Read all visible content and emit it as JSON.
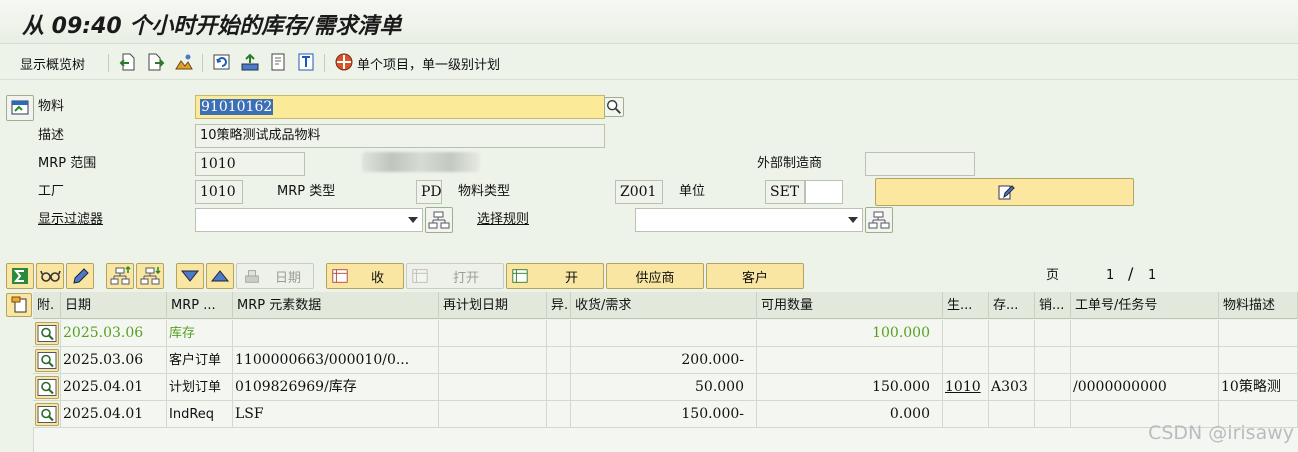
{
  "title": "从 09:40 个小时开始的库存/需求清单",
  "toolbar": {
    "overview_tree": "显示概览树",
    "single_item": "单个项目，单一级别计划"
  },
  "header": {
    "material_label": "物料",
    "material_value": "91010162",
    "desc_label": "描述",
    "desc_value": "10策略测试成品物料",
    "mrp_area_label": "MRP 范围",
    "mrp_area_value": "1010",
    "ext_mfr_label": "外部制造商",
    "ext_mfr_value": "",
    "plant_label": "工厂",
    "plant_value": "1010",
    "mrp_type_label": "MRP 类型",
    "mrp_type_value": "PD",
    "mat_type_label": "物料类型",
    "mat_type_value": "Z001",
    "unit_label": "单位",
    "unit_value": "SET",
    "filter_label": "显示过滤器",
    "rule_label": "选择规则"
  },
  "actions": {
    "date": "日期",
    "receipt": "收",
    "open": "打开",
    "open2": "开",
    "supplier": "供应商",
    "customer": "客户",
    "page_label": "页",
    "page_current": "1",
    "page_sep": "/",
    "page_total": "1"
  },
  "grid": {
    "headers": [
      "附.",
      "日期",
      "MRP ...",
      "MRP 元素数据",
      "再计划日期",
      "异.",
      "收货/需求",
      "可用数量",
      "生...",
      "存...",
      "销...",
      "工单号/任务号",
      "物料描述"
    ],
    "rows": [
      {
        "date": "2025.03.06",
        "mrp": "库存",
        "data": "",
        "resched": "",
        "exc": "",
        "qty": "",
        "avail": "100.000",
        "gen": "",
        "stor": "",
        "sales": "",
        "order": "",
        "desc": ""
      },
      {
        "date": "2025.03.06",
        "mrp": "客户订单",
        "data": "1100000663/000010/0...",
        "resched": "",
        "exc": "",
        "qty": "200.000-",
        "avail": "",
        "gen": "",
        "stor": "",
        "sales": "",
        "order": "",
        "desc": ""
      },
      {
        "date": "2025.04.01",
        "mrp": "计划订单",
        "data": "0109826969/库存",
        "resched": "",
        "exc": "",
        "qty": "50.000",
        "avail": "150.000",
        "gen": "1010",
        "stor": "A303",
        "sales": "",
        "order": "/0000000000",
        "desc": "10策略测"
      },
      {
        "date": "2025.04.01",
        "mrp": "IndReq",
        "data": "LSF",
        "resched": "",
        "exc": "",
        "qty": "150.000-",
        "avail": "0.000",
        "gen": "",
        "stor": "",
        "sales": "",
        "order": "",
        "desc": ""
      }
    ]
  },
  "watermark": "CSDN @irisawy",
  "colors": {
    "accent_yellow": "#f9e6a3",
    "stock_green": "#58a021",
    "selection_blue": "#3d6fb6"
  }
}
